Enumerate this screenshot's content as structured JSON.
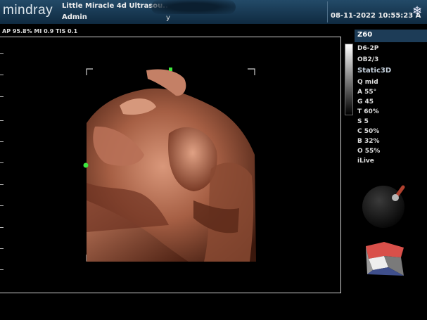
{
  "header": {
    "brand": "mindray",
    "hospital_name": "Little Miracle 4d Ultrasou..",
    "operator": "Admin",
    "patient_field": "y",
    "datetime": "08-11-2022  10:55:23 A",
    "freeze_icon": "snowflake-icon"
  },
  "acoustic": {
    "text": "AP 95.8%  MI 0.9  TIS 0.1"
  },
  "right_panel": {
    "zoom": "Z60",
    "probe": "D6-2P",
    "preset": "OB2/3",
    "mode": "Static3D",
    "params": [
      "Q mid",
      "A 55°",
      "G 45",
      "T 60%",
      "S 5",
      "C 50%",
      "B 32%",
      "O 55%",
      "iLive"
    ]
  },
  "colors": {
    "topbar": "#1a3b57",
    "frame": "#d0d0d0",
    "marker": "#3ee83e",
    "render_tone": "#b26a4c"
  },
  "icons": {
    "trackball": "trackball-orientation-icon",
    "cube": "render-cube-icon"
  }
}
